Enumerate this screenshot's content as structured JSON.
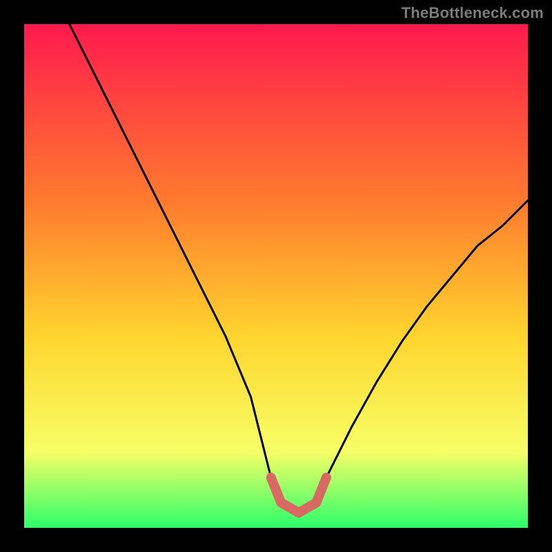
{
  "watermark": "TheBottleneck.com",
  "colors": {
    "frame": "#000000",
    "gradient_top": "#ff1a4d",
    "gradient_mid1": "#ff7a2e",
    "gradient_mid2": "#ffd52e",
    "gradient_mid3": "#f6ff66",
    "gradient_bottom": "#2dff6a",
    "curve": "#000000",
    "marker": "#d96a63"
  },
  "chart_data": {
    "type": "line",
    "title": "",
    "xlabel": "",
    "ylabel": "",
    "xlim": [
      0,
      100
    ],
    "ylim": [
      0,
      100
    ],
    "series": [
      {
        "name": "bottleneck-curve",
        "x": [
          9,
          15,
          20,
          25,
          30,
          35,
          40,
          45,
          47,
          49,
          51,
          53,
          55,
          56,
          58,
          60,
          65,
          70,
          75,
          80,
          85,
          90,
          95,
          100
        ],
        "values": [
          100,
          88,
          78,
          68,
          58,
          48,
          38,
          26,
          18,
          10,
          5,
          3,
          3,
          3,
          5,
          10,
          20,
          29,
          37,
          44,
          50,
          56,
          60,
          65
        ]
      }
    ],
    "flat_region": {
      "x_start": 51,
      "x_end": 58,
      "value": 3
    },
    "annotations": [
      {
        "text": "TheBottleneck.com",
        "role": "watermark",
        "position": "top-right"
      }
    ]
  }
}
